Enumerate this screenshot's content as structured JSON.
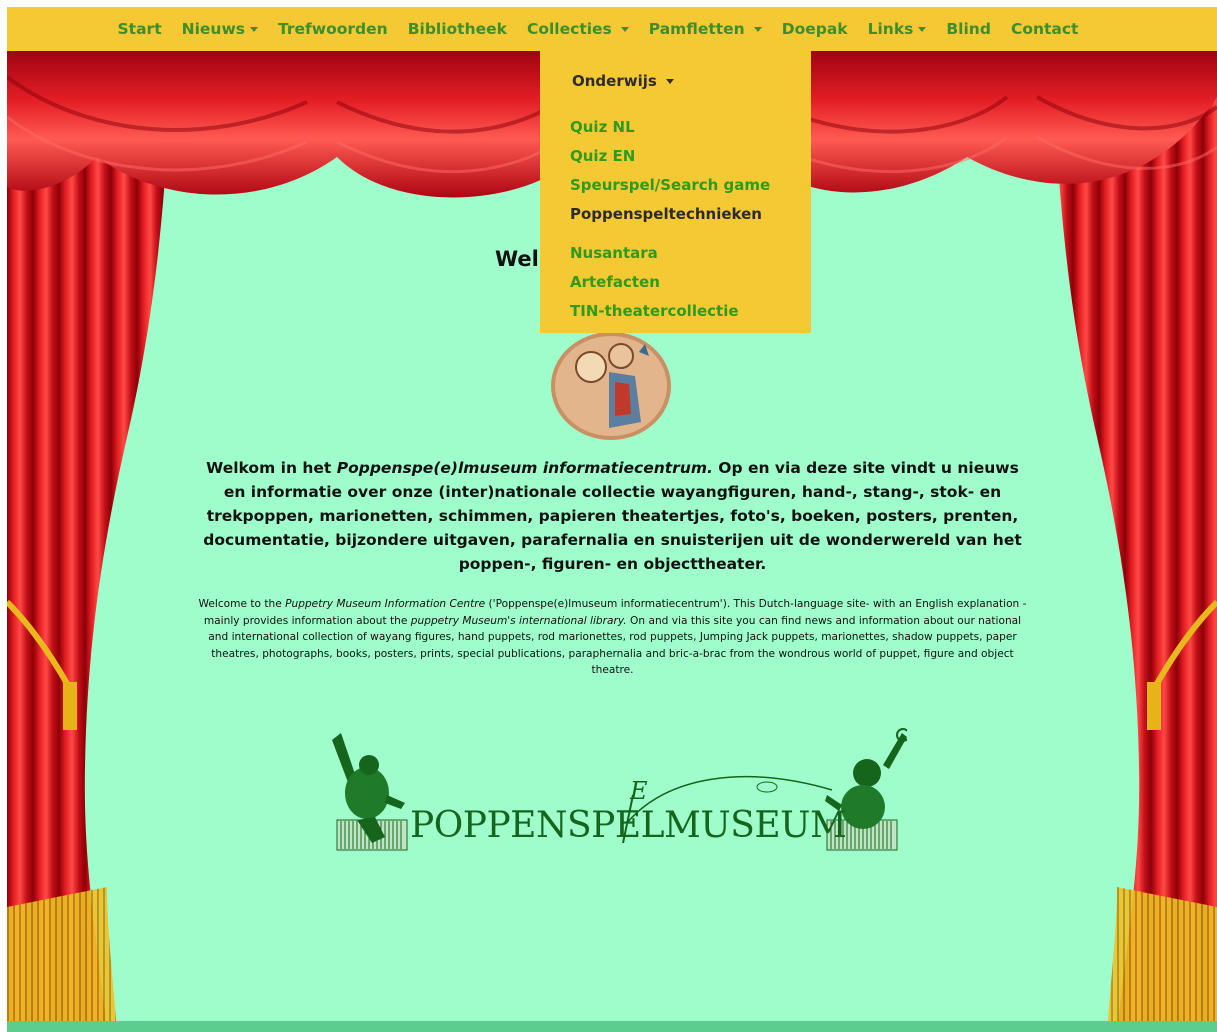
{
  "nav": {
    "items": [
      {
        "label": "Start",
        "has_caret": false
      },
      {
        "label": "Nieuws",
        "has_caret": true
      },
      {
        "label": "Trefwoorden",
        "has_caret": false
      },
      {
        "label": "Bibliotheek",
        "has_caret": false
      },
      {
        "label": "Collecties",
        "has_caret": true
      },
      {
        "label": "Pamfletten",
        "has_caret": true
      },
      {
        "label": "Doepak",
        "has_caret": false
      },
      {
        "label": "Links",
        "has_caret": true
      },
      {
        "label": "Blind",
        "has_caret": false
      },
      {
        "label": "Contact",
        "has_caret": false
      }
    ]
  },
  "dropdown": {
    "submenu_label": "Onderwijs",
    "links": [
      {
        "label": "Quiz NL"
      },
      {
        "label": "Quiz EN"
      },
      {
        "label": "Speurspel/Search game"
      },
      {
        "label": "Poppenspeltechnieken"
      },
      {
        "label": "Nusantara"
      },
      {
        "label": "Artefacten"
      },
      {
        "label": "TIN-theatercollectie"
      }
    ]
  },
  "main": {
    "heading_visible": "Wel",
    "intro_nl": {
      "prefix": "Welkom in het ",
      "emphasis": "Poppenspe(e)lmuseum informatiecentrum.",
      "rest": " Op en via deze site vindt u nieuws en informatie over onze (inter)nationale collectie wayangfiguren, hand-, stang-, stok- en trekpoppen, marionetten, schimmen, papieren theatertjes, foto's, boeken, posters, prenten, documentatie, bijzondere uitgaven, parafernalia en snuisterijen uit de wonderwereld van het poppen-, figuren- en objecttheater."
    },
    "intro_en": {
      "p1": "Welcome to the ",
      "em1": "Puppetry Museum Information Centre",
      "p2": " ('Poppenspe(e)lmuseum informatiecentrum'). This Dutch-language site- with an English explanation - mainly provides information about the ",
      "em2": "puppetry Museum's international library.",
      "p3": " On and via this site you can find news and information about our national and international collection of wayang figures, hand puppets, rod marionettes, rod puppets, Jumping Jack puppets, marionettes, shadow puppets, paper theatres, photographs, books, posters, prints, special publications, paraphernalia and bric-a-brac from the wondrous world of puppet, figure and object theatre."
    },
    "logo": {
      "text": "POPPENSPELMUSEUM",
      "overlay_letter": "E"
    }
  },
  "colors": {
    "navbar": "#f5c933",
    "nav_text": "#3c8f2c",
    "background": "#9ffdcc",
    "curtain": "#d3131b",
    "fringe": "#e6b416",
    "logo": "#15651c",
    "footer": "#5ccd8e"
  }
}
